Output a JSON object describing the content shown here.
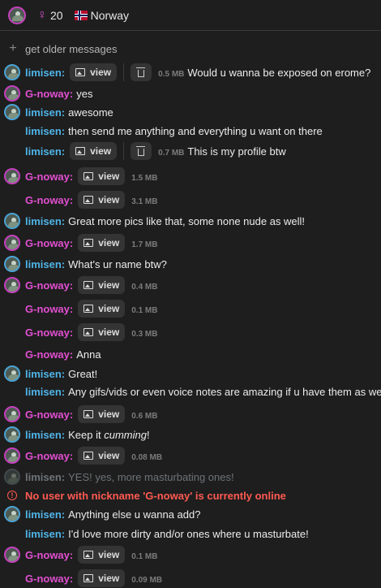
{
  "header": {
    "age": "20",
    "gender_icon": "♀",
    "country": "Norway"
  },
  "older": {
    "label": "get older messages"
  },
  "messages": [
    {
      "avatar": "m",
      "nick": "limisen:",
      "cls": "m",
      "view": "view",
      "trash": true,
      "size": "0.5 MB",
      "after": "Would u wanna be exposed on erome?"
    },
    {
      "avatar": "f",
      "nick": "G-noway:",
      "cls": "f",
      "text": "yes"
    },
    {
      "avatar": "m",
      "nick": "limisen:",
      "cls": "m",
      "text": "awesome"
    },
    {
      "avatar": "",
      "nick": "limisen:",
      "cls": "m",
      "text": "then send me anything and everything u want on there"
    },
    {
      "avatar": "",
      "nick": "limisen:",
      "cls": "m",
      "view": "view",
      "trash": true,
      "size": "0.7 MB",
      "after": "This is my profile btw"
    },
    {
      "avatar": "f",
      "nick": "G-noway:",
      "cls": "f",
      "view": "view",
      "size": "1.5 MB"
    },
    {
      "avatar": "",
      "nick": "G-noway:",
      "cls": "f",
      "view": "view",
      "size": "3.1 MB"
    },
    {
      "avatar": "m",
      "nick": "limisen:",
      "cls": "m",
      "text": "Great more pics like that, some none nude as well!"
    },
    {
      "avatar": "f",
      "nick": "G-noway:",
      "cls": "f",
      "view": "view",
      "size": "1.7 MB"
    },
    {
      "avatar": "m",
      "nick": "limisen:",
      "cls": "m",
      "text": "What's ur name btw?"
    },
    {
      "avatar": "f",
      "nick": "G-noway:",
      "cls": "f",
      "view": "view",
      "size": "0.4 MB"
    },
    {
      "avatar": "",
      "nick": "G-noway:",
      "cls": "f",
      "view": "view",
      "size": "0.1 MB"
    },
    {
      "avatar": "",
      "nick": "G-noway:",
      "cls": "f",
      "view": "view",
      "size": "0.3 MB"
    },
    {
      "avatar": "",
      "nick": "G-noway:",
      "cls": "f",
      "text": "Anna"
    },
    {
      "avatar": "m",
      "nick": "limisen:",
      "cls": "m",
      "text": "Great!"
    },
    {
      "avatar": "",
      "nick": "limisen:",
      "cls": "m",
      "text": "Any gifs/vids or even voice notes are amazing if u have them as well!"
    },
    {
      "avatar": "f",
      "nick": "G-noway:",
      "cls": "f",
      "view": "view",
      "size": "0.6 MB"
    },
    {
      "avatar": "m",
      "nick": "limisen:",
      "cls": "m",
      "text_pre": "Keep it ",
      "text_em": "cumming",
      "text_post": "!"
    },
    {
      "avatar": "f",
      "nick": "G-noway:",
      "cls": "f",
      "view": "view",
      "size": "0.08 MB"
    },
    {
      "avatar": "dim",
      "nick": "limisen:",
      "cls": "m",
      "ghost": true,
      "text": "YES! yes, more masturbating ones!"
    },
    {
      "error": true,
      "text": "No user with nickname 'G-noway' is currently online"
    },
    {
      "avatar": "m",
      "nick": "limisen:",
      "cls": "m",
      "text": "Anything else u wanna add?"
    },
    {
      "avatar": "",
      "nick": "limisen:",
      "cls": "m",
      "text": "I'd love more dirty and/or ones where u masturbate!"
    },
    {
      "avatar": "f",
      "nick": "G-noway:",
      "cls": "f",
      "view": "view",
      "size": "0.1 MB"
    },
    {
      "avatar": "",
      "nick": "G-noway:",
      "cls": "f",
      "view": "view",
      "size": "0.09 MB"
    }
  ]
}
